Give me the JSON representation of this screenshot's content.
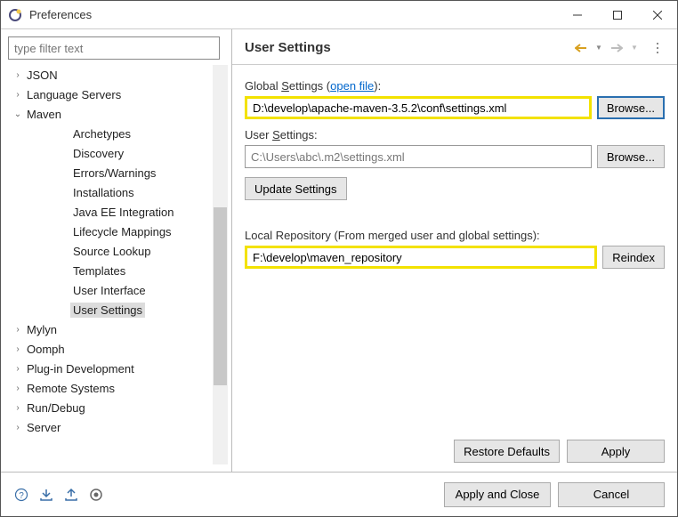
{
  "window": {
    "title": "Preferences"
  },
  "filter": {
    "placeholder": "type filter text"
  },
  "tree": [
    {
      "label": "JSON",
      "level": "node",
      "expand": ">"
    },
    {
      "label": "Language Servers",
      "level": "node",
      "expand": ">"
    },
    {
      "label": "Maven",
      "level": "node",
      "expand": "v"
    },
    {
      "label": "Archetypes",
      "level": "grand",
      "expand": ""
    },
    {
      "label": "Discovery",
      "level": "grand",
      "expand": ""
    },
    {
      "label": "Errors/Warnings",
      "level": "grand",
      "expand": ""
    },
    {
      "label": "Installations",
      "level": "grand",
      "expand": ""
    },
    {
      "label": "Java EE Integration",
      "level": "grand",
      "expand": ""
    },
    {
      "label": "Lifecycle Mappings",
      "level": "grand",
      "expand": ""
    },
    {
      "label": "Source Lookup",
      "level": "grand",
      "expand": ""
    },
    {
      "label": "Templates",
      "level": "grand",
      "expand": ""
    },
    {
      "label": "User Interface",
      "level": "grand",
      "expand": ""
    },
    {
      "label": "User Settings",
      "level": "grand",
      "expand": "",
      "selected": true
    },
    {
      "label": "Mylyn",
      "level": "node",
      "expand": ">"
    },
    {
      "label": "Oomph",
      "level": "node",
      "expand": ">"
    },
    {
      "label": "Plug-in Development",
      "level": "node",
      "expand": ">"
    },
    {
      "label": "Remote Systems",
      "level": "node",
      "expand": ">"
    },
    {
      "label": "Run/Debug",
      "level": "node",
      "expand": ">"
    },
    {
      "label": "Server",
      "level": "node",
      "expand": ">"
    }
  ],
  "page": {
    "title": "User Settings",
    "global_label_pre": "Global ",
    "global_label_u": "S",
    "global_label_post": "ettings (",
    "open_file": "open file",
    "global_label_end": "):",
    "global_value": "D:\\develop\\apache-maven-3.5.2\\conf\\settings.xml",
    "browse": "Browse...",
    "user_label_pre": "User ",
    "user_label_u": "S",
    "user_label_post": "ettings:",
    "user_value": "C:\\Users\\abc\\.m2\\settings.xml",
    "update": "Update Settings",
    "repo_label": "Local Repository (From merged user and global settings):",
    "repo_value": "F:\\develop\\maven_repository",
    "reindex": "Reindex",
    "restore": "Restore Defaults",
    "apply": "Apply"
  },
  "footer": {
    "apply_close": "Apply and Close",
    "cancel": "Cancel"
  }
}
